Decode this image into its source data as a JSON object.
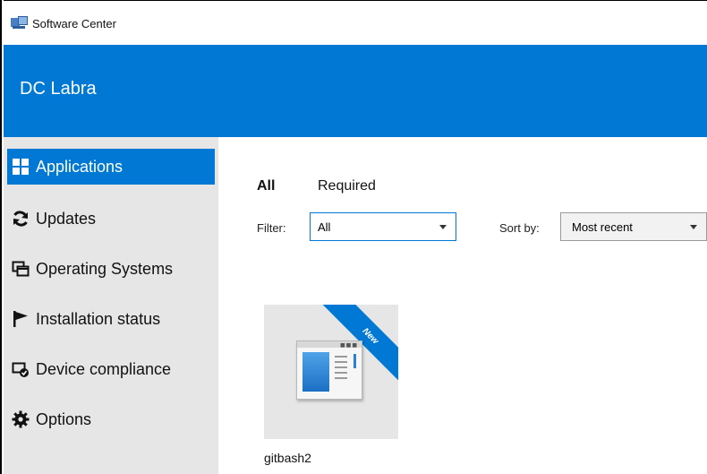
{
  "window": {
    "title": "Software Center",
    "icon": "software-center-app-icon"
  },
  "header": {
    "organization": "DC Labra",
    "color": "#0078d4"
  },
  "sidebar": {
    "items": [
      {
        "label": "Applications",
        "icon": "applications-grid-icon",
        "active": true
      },
      {
        "label": "Updates",
        "icon": "refresh-icon",
        "active": false
      },
      {
        "label": "Operating Systems",
        "icon": "operating-systems-icon",
        "active": false
      },
      {
        "label": "Installation status",
        "icon": "flag-icon",
        "active": false
      },
      {
        "label": "Device compliance",
        "icon": "device-compliance-icon",
        "active": false
      },
      {
        "label": "Options",
        "icon": "gear-icon",
        "active": false
      }
    ]
  },
  "main": {
    "tabs": [
      {
        "label": "All",
        "active": true
      },
      {
        "label": "Required",
        "active": false
      }
    ],
    "filter": {
      "label": "Filter:",
      "value": "All"
    },
    "sort": {
      "label": "Sort by:",
      "value": "Most recent"
    },
    "apps": [
      {
        "name": "gitbash2",
        "badge": "New",
        "icon": "application-window-icon"
      }
    ]
  }
}
